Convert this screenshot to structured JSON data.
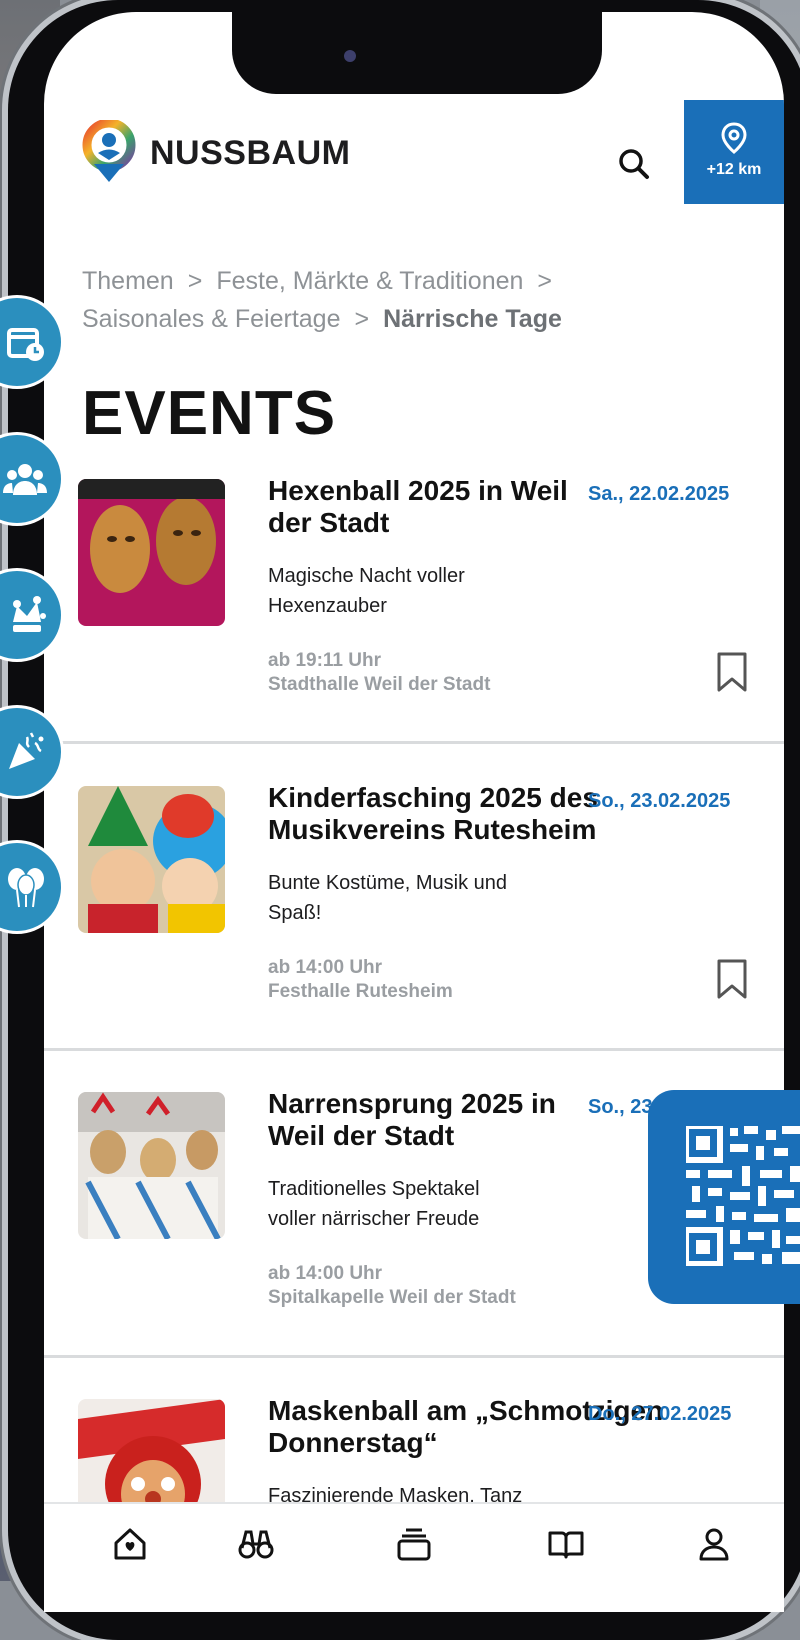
{
  "app": {
    "brand": "NUSSBAUM",
    "distance_label": "+12 km"
  },
  "breadcrumb": {
    "items": [
      "Themen",
      "Feste, Märkte & Traditionen",
      "Saisonales & Feiertage"
    ],
    "current": "Närrische Tage"
  },
  "page": {
    "title": "EVENTS"
  },
  "events": [
    {
      "title": "Hexenball 2025 in Weil der Stadt",
      "date": "Sa., 22.02.2025",
      "description": "Magische Nacht voller Hexenzauber",
      "time": "ab 19:11 Uhr",
      "location": "Stadthalle Weil der Stadt"
    },
    {
      "title": "Kinderfasching 2025 des Musikvereins Rutesheim",
      "date": "So., 23.02.2025",
      "description": "Bunte Kostüme, Musik und Spaß!",
      "time": "ab 14:00 Uhr",
      "location": "Festhalle Rutesheim"
    },
    {
      "title": "Narrensprung 2025 in Weil der Stadt",
      "date": "So., 23",
      "description": "Traditionelles Spektakel voller närrischer Freude",
      "time": "ab 14:00 Uhr",
      "location": "Spitalkapelle Weil der Stadt"
    },
    {
      "title": "Maskenball am „Schmotzigen Donnerstag“",
      "date": "Do., 27.02.2025",
      "description": "Faszinierende Masken, Tanz",
      "time": "",
      "location": ""
    }
  ],
  "category_icons": [
    "calendar-clock-icon",
    "group-icon",
    "jester-hat-icon",
    "party-popper-icon",
    "balloons-icon"
  ],
  "bottom_nav": [
    "home-icon",
    "binoculars-icon",
    "collections-icon",
    "book-icon",
    "profile-icon"
  ],
  "colors": {
    "accent": "#1a6fb8",
    "category": "#2b8fbe",
    "text": "#121212",
    "muted": "#9a9ea2"
  }
}
